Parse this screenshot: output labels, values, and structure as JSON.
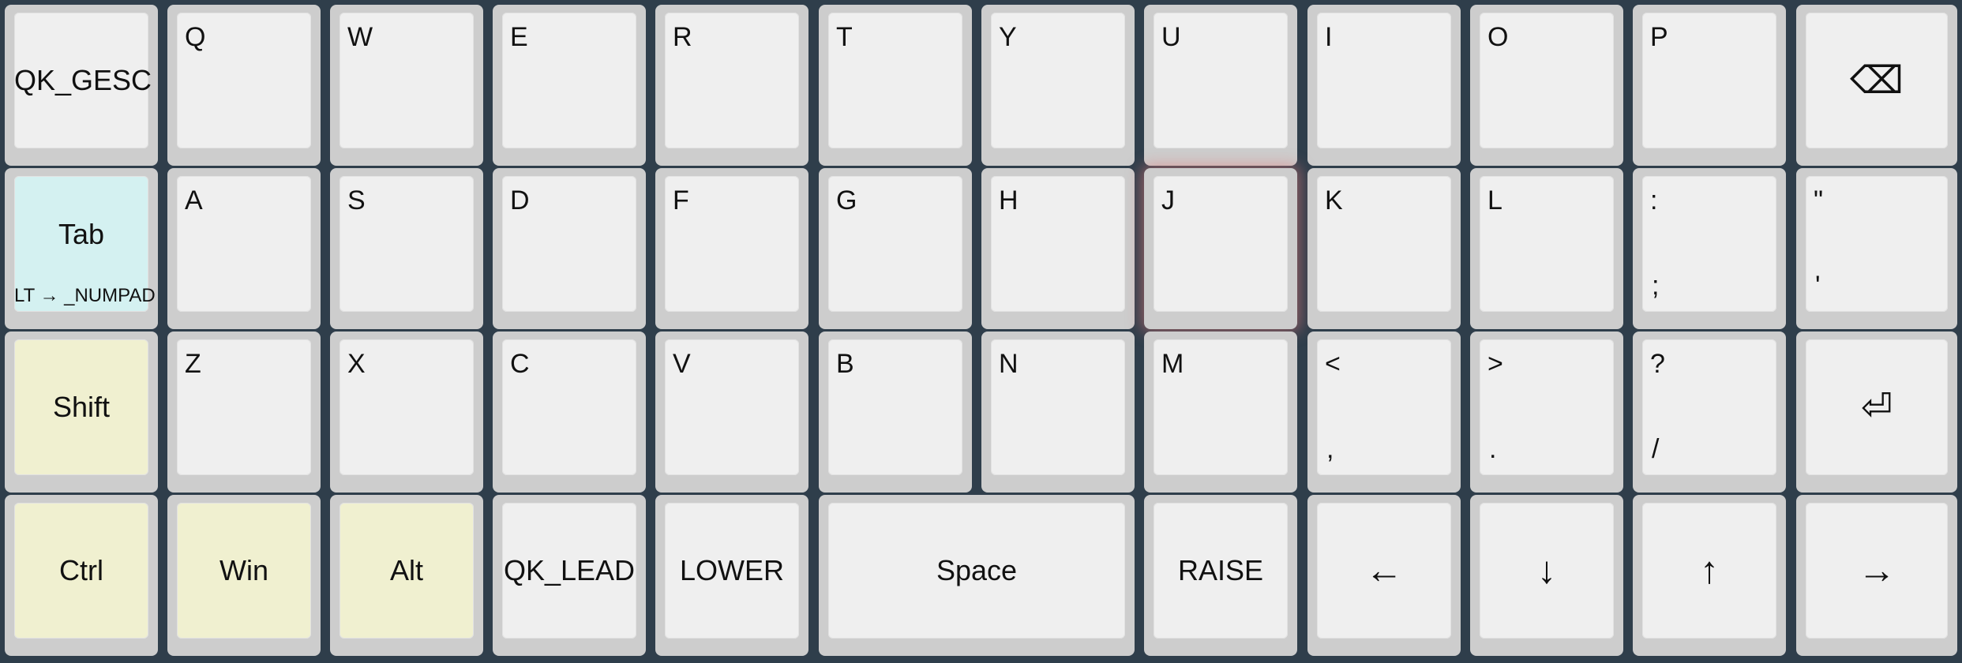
{
  "keyboard": {
    "row1": [
      {
        "label": "QK_GESC"
      },
      {
        "label": "Q"
      },
      {
        "label": "W"
      },
      {
        "label": "E"
      },
      {
        "label": "R"
      },
      {
        "label": "T"
      },
      {
        "label": "Y"
      },
      {
        "label": "U"
      },
      {
        "label": "I"
      },
      {
        "label": "O"
      },
      {
        "label": "P"
      },
      {
        "label": "⌫",
        "icon": "backspace-icon"
      }
    ],
    "row2": [
      {
        "label": "Tab",
        "hold": "LT → _NUMPAD"
      },
      {
        "label": "A"
      },
      {
        "label": "S"
      },
      {
        "label": "D"
      },
      {
        "label": "F"
      },
      {
        "label": "G"
      },
      {
        "label": "H"
      },
      {
        "label": "J"
      },
      {
        "label": "K"
      },
      {
        "label": "L"
      },
      {
        "shift": ":",
        "base": ";"
      },
      {
        "shift": "\"",
        "base": "'"
      }
    ],
    "row3": [
      {
        "label": "Shift"
      },
      {
        "label": "Z"
      },
      {
        "label": "X"
      },
      {
        "label": "C"
      },
      {
        "label": "V"
      },
      {
        "label": "B"
      },
      {
        "label": "N"
      },
      {
        "label": "M"
      },
      {
        "shift": "<",
        "base": ","
      },
      {
        "shift": ">",
        "base": "."
      },
      {
        "shift": "?",
        "base": "/"
      },
      {
        "label": "⏎",
        "icon": "enter-icon"
      }
    ],
    "row4": [
      {
        "label": "Ctrl"
      },
      {
        "label": "Win"
      },
      {
        "label": "Alt"
      },
      {
        "label": "QK_LEAD"
      },
      {
        "label": "LOWER"
      },
      {
        "label": "Space"
      },
      {
        "label": "RAISE"
      },
      {
        "label": "←",
        "icon": "arrow-left-icon"
      },
      {
        "label": "↓",
        "icon": "arrow-down-icon"
      },
      {
        "label": "↑",
        "icon": "arrow-up-icon"
      },
      {
        "label": "→",
        "icon": "arrow-right-icon"
      }
    ]
  },
  "colors": {
    "background": "#2f3e4b",
    "key_border": "#cdcdcd",
    "key_face": "#efefef",
    "modifier_face": "#f0f0d0",
    "layer_face": "#d4f1f1",
    "highlight_glow": "#e07878"
  }
}
